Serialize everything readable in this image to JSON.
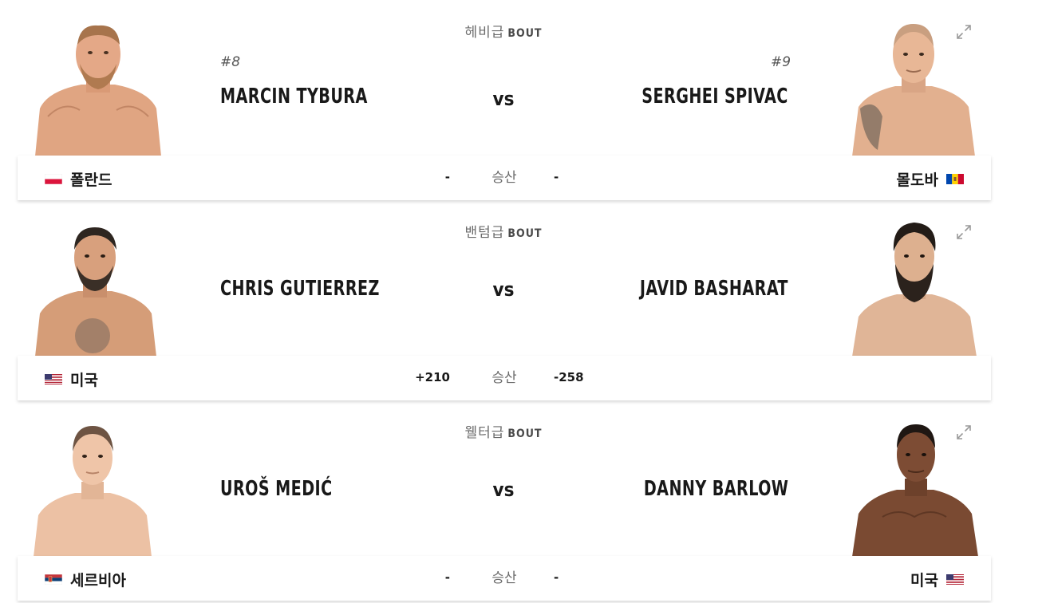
{
  "colors": {
    "text": "#191919",
    "muted": "#6b6b6b",
    "card_bg": "#ffffff"
  },
  "bouts": [
    {
      "weight_class": "헤비급",
      "bout_label": "BOUT",
      "red": {
        "rank": "#8",
        "name": "MARCIN TYBURA",
        "country": "폴란드",
        "odds": "-",
        "flag": "poland-flag"
      },
      "blue": {
        "rank": "#9",
        "name": "SERGHEI SPIVAC",
        "country": "몰도바",
        "odds": "-",
        "flag": "moldova-flag"
      },
      "vs": "vs",
      "result": "승산"
    },
    {
      "weight_class": "밴텀급",
      "bout_label": "BOUT",
      "red": {
        "rank": "",
        "name": "CHRIS GUTIERREZ",
        "country": "미국",
        "odds": "+210",
        "flag": "usa-flag"
      },
      "blue": {
        "rank": "",
        "name": "JAVID BASHARAT",
        "country": "",
        "odds": "-258",
        "flag": ""
      },
      "vs": "vs",
      "result": "승산"
    },
    {
      "weight_class": "웰터급",
      "bout_label": "BOUT",
      "red": {
        "rank": "",
        "name": "UROŠ MEDIĆ",
        "country": "세르비아",
        "odds": "-",
        "flag": "serbia-flag"
      },
      "blue": {
        "rank": "",
        "name": "DANNY BARLOW",
        "country": "미국",
        "odds": "-",
        "flag": "usa-flag"
      },
      "vs": "vs",
      "result": "승산"
    }
  ]
}
